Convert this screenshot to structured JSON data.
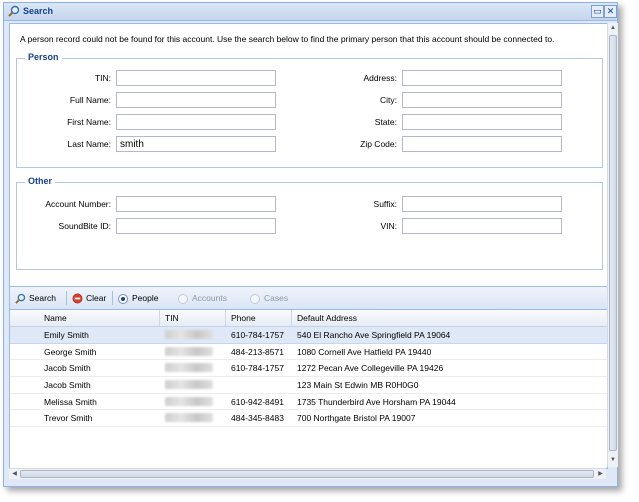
{
  "window": {
    "title": "Search",
    "minimize_icon": "minimize-icon",
    "close_icon": "close-icon"
  },
  "intro_text": "A person record could not be found for this account. Use the search below to find the primary person that this account should be connected to.",
  "person": {
    "legend": "Person",
    "tin": {
      "label": "TIN:",
      "value": ""
    },
    "full_name": {
      "label": "Full Name:",
      "value": ""
    },
    "first_name": {
      "label": "First Name:",
      "value": ""
    },
    "last_name": {
      "label": "Last Name:",
      "value": "smith"
    },
    "address": {
      "label": "Address:",
      "value": ""
    },
    "city": {
      "label": "City:",
      "value": ""
    },
    "state": {
      "label": "State:",
      "value": ""
    },
    "zip": {
      "label": "Zip Code:",
      "value": ""
    }
  },
  "other": {
    "legend": "Other",
    "account_number": {
      "label": "Account Number:",
      "value": ""
    },
    "soundbite_id": {
      "label": "SoundBite ID:",
      "value": ""
    },
    "suffix": {
      "label": "Suffix:",
      "value": ""
    },
    "vin": {
      "label": "VIN:",
      "value": ""
    }
  },
  "toolbar": {
    "search_label": "Search",
    "clear_label": "Clear",
    "people_label": "People",
    "accounts_label": "Accounts",
    "cases_label": "Cases",
    "selected_mode": "People"
  },
  "grid": {
    "columns": [
      "Name",
      "TIN",
      "Phone",
      "Default Address"
    ],
    "rows": [
      {
        "name": "Emily Smith",
        "tin": "",
        "phone": "610-784-1757",
        "address": "540 El Rancho Ave Springfield PA 19064",
        "selected": true
      },
      {
        "name": "George Smith",
        "tin": "",
        "phone": "484-213-8571",
        "address": "1080 Cornell Ave Hatfield PA 19440",
        "selected": false
      },
      {
        "name": "Jacob Smith",
        "tin": "",
        "phone": "610-784-1757",
        "address": "1272 Pecan Ave Collegeville PA 19426",
        "selected": false
      },
      {
        "name": "Jacob Smith",
        "tin": "",
        "phone": "",
        "address": "123 Main St Edwin MB R0H0G0",
        "selected": false
      },
      {
        "name": "Melissa Smith",
        "tin": "",
        "phone": "610-942-8491",
        "address": "1735 Thunderbird Ave Horsham PA 19044",
        "selected": false
      },
      {
        "name": "Trevor Smith",
        "tin": "",
        "phone": "484-345-8483",
        "address": "700 Northgate Bristol PA 19007",
        "selected": false
      }
    ]
  },
  "colors": {
    "accent": "#15428b",
    "border": "#99bbe8",
    "selected_row": "#dfe8f6"
  }
}
